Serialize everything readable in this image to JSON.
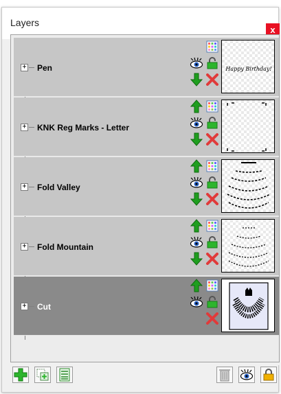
{
  "window": {
    "title": "Layers",
    "close_label": "x"
  },
  "layers": [
    {
      "name": "Pen",
      "thumbnail_text": "Happy Birthday!",
      "selected": false,
      "has_up": false,
      "has_down": true
    },
    {
      "name": "KNK Reg Marks - Letter",
      "selected": false,
      "has_up": true,
      "has_down": true
    },
    {
      "name": "Fold Valley",
      "selected": false,
      "has_up": true,
      "has_down": true
    },
    {
      "name": "Fold Mountain",
      "selected": false,
      "has_up": true,
      "has_down": true
    },
    {
      "name": "Cut",
      "selected": true,
      "has_up": true,
      "has_down": false
    }
  ],
  "expander_symbol": "+",
  "colors": {
    "row_bg": "#c6c6c6",
    "row_selected_bg": "#8a8a8a",
    "arrow_green": "#1f9e1f",
    "delete_red": "#e03a3a",
    "lock_green": "#2db52d",
    "close_red": "#e81123"
  },
  "icons": {
    "move_up": "green-up-arrow-icon",
    "move_down": "green-down-arrow-icon",
    "color": "color-grid-icon",
    "visibility": "eye-icon",
    "lock": "padlock-icon",
    "delete": "red-x-icon",
    "add_layer": "green-plus-icon",
    "duplicate_layer": "duplicate-icon",
    "merge_layer": "layer-list-icon",
    "trash": "trash-icon",
    "toggle_all_visibility": "eye-icon",
    "toggle_all_lock": "padlock-icon"
  }
}
